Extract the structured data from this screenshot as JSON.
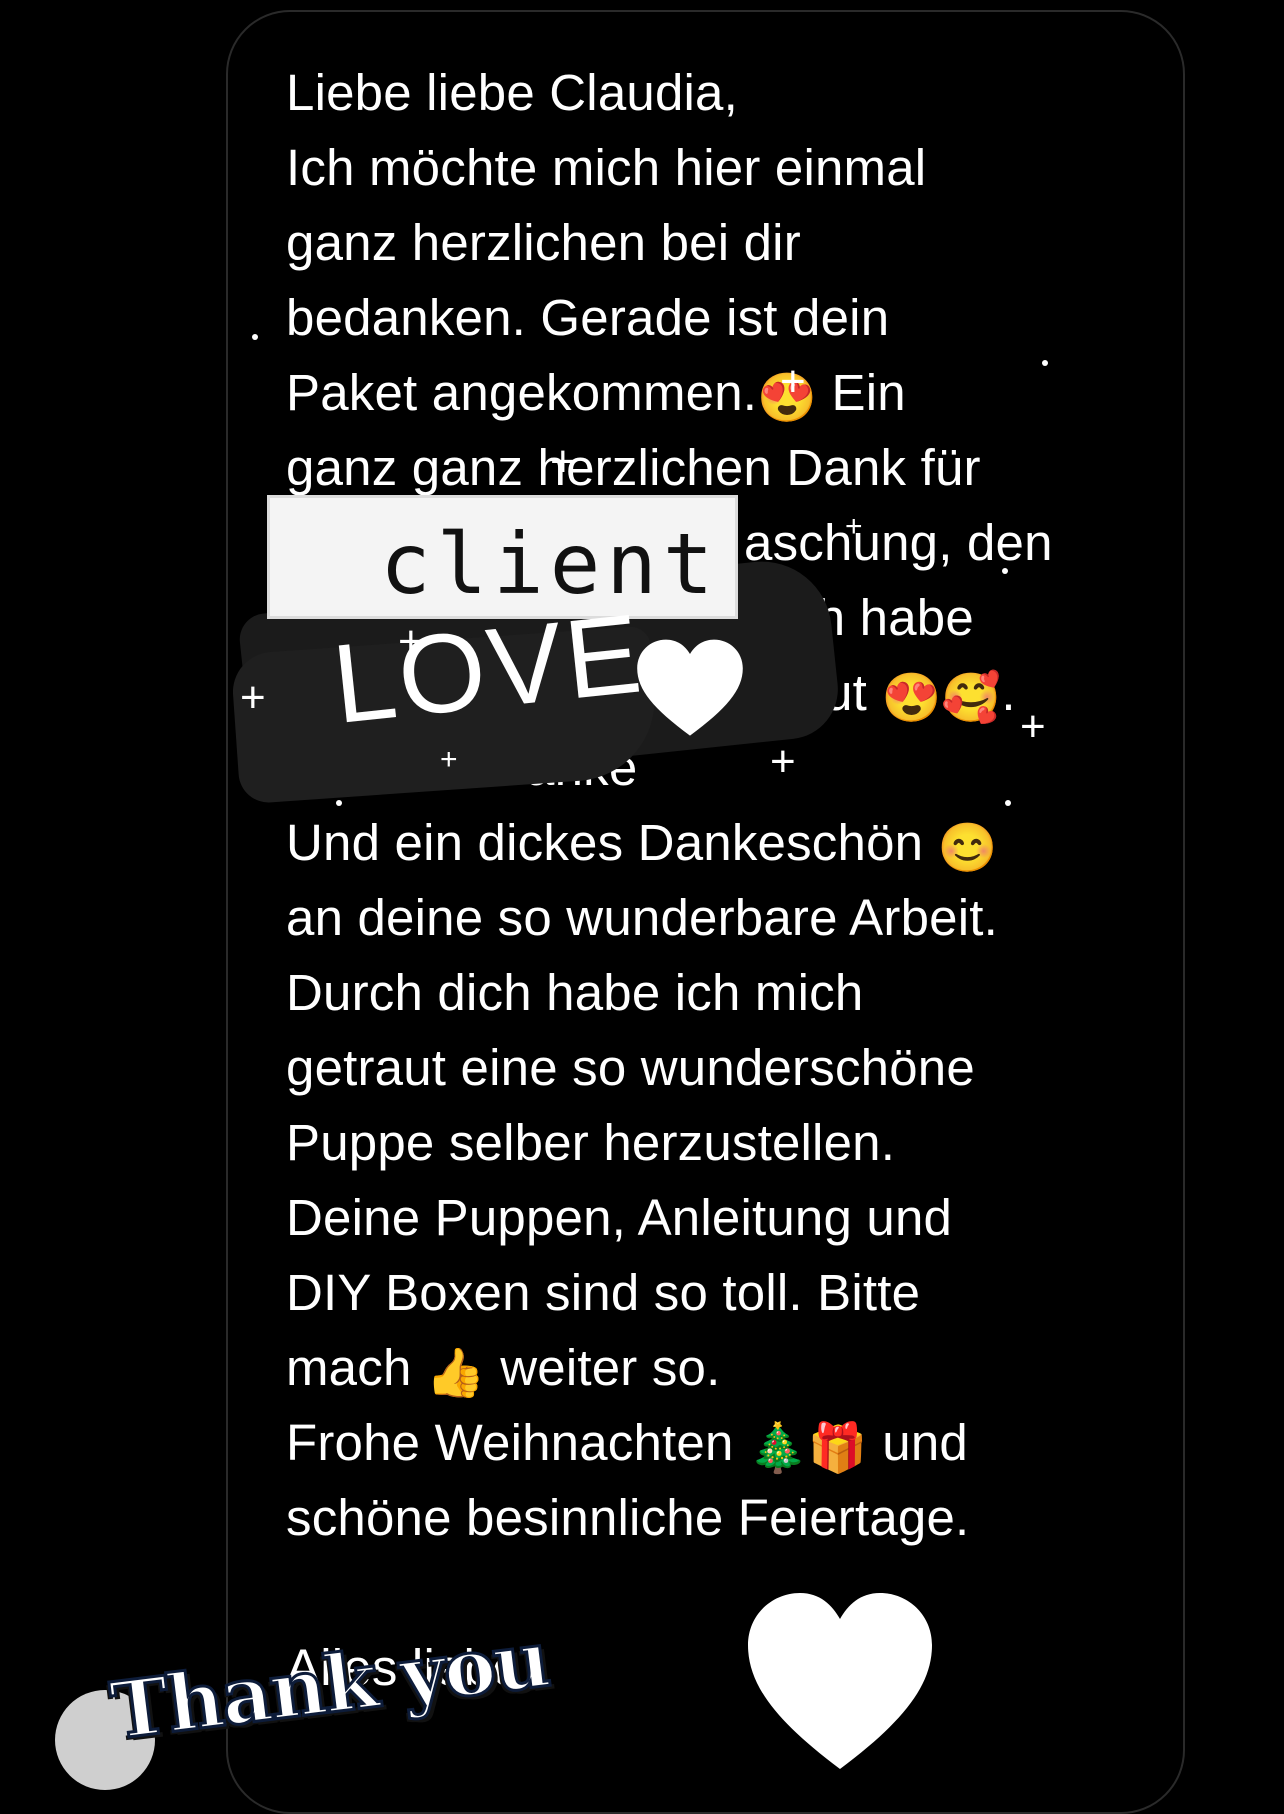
{
  "message": {
    "lines": [
      "Liebe liebe Claudia,",
      "Ich möchte mich hier einmal",
      "ganz herzlichen bei dir",
      "bedanken. Gerade ist dein",
      "Paket angekommen.",
      "ganz ganz herzlichen Dank für",
      "aschung, den",
      "ch habe",
      "freut",
      "anke",
      "Und ein dickes Dankeschön",
      "an deine so wunderbare Arbeit.",
      "Durch dich habe ich mich",
      "getraut eine so wunderschöne",
      "Puppe selber herzustellen.",
      "Deine Puppen, Anleitung und",
      "DIY Boxen sind so toll. Bitte",
      "mach",
      "weiter so.",
      "Frohe Weihnachten",
      "und",
      "schöne besinnliche Feiertage.",
      "Alles liebe"
    ],
    "word_ein": "Ein",
    "emojis": {
      "heart_eyes": "😍",
      "smiling_hearts": "🥰",
      "blush": "😊",
      "thumbs_up": "👍",
      "tree": "🎄",
      "gift": "🎁"
    }
  },
  "sticker": {
    "client_label": "client",
    "love_label": "LOVE",
    "heart_icon": "heart-icon"
  },
  "thank_you": {
    "label": "Thank you",
    "heart_icon": "heart-icon"
  },
  "colors": {
    "background": "#000000",
    "text": "#ffffff",
    "sticker_box": "#f4f4f4",
    "brush": "#1b1b1b"
  }
}
